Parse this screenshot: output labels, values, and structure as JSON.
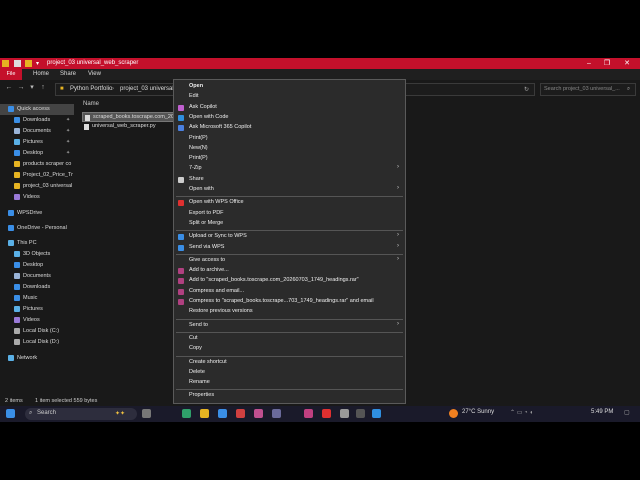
{
  "window": {
    "title": "project_03 universal_web_scraper"
  },
  "ribbon": {
    "tabs": [
      "File",
      "Home",
      "Share",
      "View"
    ]
  },
  "address": {
    "crumbs": [
      "Python Portfolio",
      "project_03 universal_w"
    ],
    "search_placeholder": "Search project_03 universal_..."
  },
  "nav": {
    "items": [
      {
        "label": "Quick access",
        "icon": "star-icon",
        "color": "#3a8ee6"
      },
      {
        "label": "Downloads",
        "icon": "download-icon",
        "color": "#3a8ee6",
        "pinned": true
      },
      {
        "label": "Documents",
        "icon": "documents-icon",
        "color": "#9ab4d8",
        "pinned": true
      },
      {
        "label": "Pictures",
        "icon": "pictures-icon",
        "color": "#5ab0e6",
        "pinned": true
      },
      {
        "label": "Desktop",
        "icon": "desktop-icon",
        "color": "#3a8ee6",
        "pinned": true
      },
      {
        "label": "products scraper co",
        "icon": "folder-icon",
        "color": "#e6b422"
      },
      {
        "label": "Project_02_Price_Tr",
        "icon": "folder-icon",
        "color": "#e6b422"
      },
      {
        "label": "project_03 universal",
        "icon": "folder-icon",
        "color": "#e6b422"
      },
      {
        "label": "Videos",
        "icon": "videos-icon",
        "color": "#9a7ad8"
      },
      {
        "label": "WPSDrive",
        "icon": "cloud-icon",
        "color": "#3a8ee6"
      },
      {
        "label": "OneDrive - Personal",
        "icon": "onedrive-icon",
        "color": "#3a8ee6"
      },
      {
        "label": "This PC",
        "icon": "pc-icon",
        "color": "#5ab0e6"
      },
      {
        "label": "3D Objects",
        "icon": "cube-icon",
        "color": "#5ab0e6"
      },
      {
        "label": "Desktop",
        "icon": "desktop-icon",
        "color": "#3a8ee6"
      },
      {
        "label": "Documents",
        "icon": "documents-icon",
        "color": "#9ab4d8"
      },
      {
        "label": "Downloads",
        "icon": "download-icon",
        "color": "#3a8ee6"
      },
      {
        "label": "Music",
        "icon": "music-icon",
        "color": "#3a8ee6"
      },
      {
        "label": "Pictures",
        "icon": "pictures-icon",
        "color": "#5ab0e6"
      },
      {
        "label": "Videos",
        "icon": "videos-icon",
        "color": "#9a7ad8"
      },
      {
        "label": "Local Disk (C:)",
        "icon": "disk-icon",
        "color": "#aaaaaa"
      },
      {
        "label": "Local Disk (D:)",
        "icon": "disk-icon",
        "color": "#aaaaaa"
      },
      {
        "label": "Network",
        "icon": "network-icon",
        "color": "#5ab0e6"
      }
    ]
  },
  "files": {
    "column_name": "Name",
    "items": [
      {
        "name": "scraped_books.toscrape.com_20",
        "selected": true
      },
      {
        "name": "universal_web_scraper.py",
        "selected": false
      }
    ]
  },
  "status": {
    "count": "2 items",
    "selection": "1 item selected  559 bytes"
  },
  "menu": {
    "items": [
      {
        "label": "Open",
        "bold": true
      },
      {
        "label": "Edit"
      },
      {
        "label": "Ask Copilot",
        "icon": "copilot-icon",
        "color": "#c060d0"
      },
      {
        "label": "Open with Code",
        "icon": "vscode-icon",
        "color": "#2f8fe0"
      },
      {
        "label": "Ask Microsoft 365 Copilot",
        "icon": "m365-copilot-icon",
        "color": "#4a80e0"
      },
      {
        "label": "Print(P)"
      },
      {
        "label": "New(N)"
      },
      {
        "label": "Print(P)"
      },
      {
        "label": "7-Zip",
        "submenu": true
      },
      {
        "label": "Share",
        "icon": "share-icon",
        "color": "#cccccc"
      },
      {
        "label": "Open with",
        "submenu": true
      },
      {
        "sep": true
      },
      {
        "label": "Open with WPS Office",
        "icon": "wps-icon",
        "color": "#e03030"
      },
      {
        "label": "Export to PDF"
      },
      {
        "label": "Split or Merge"
      },
      {
        "sep": true
      },
      {
        "label": "Upload or Sync to WPS",
        "icon": "cloud-upload-icon",
        "color": "#3a8ee6",
        "submenu": true
      },
      {
        "label": "Send via WPS",
        "icon": "send-icon",
        "color": "#3a8ee6",
        "submenu": true
      },
      {
        "sep": true
      },
      {
        "label": "Give access to",
        "submenu": true
      },
      {
        "label": "Add to archive...",
        "icon": "winrar-icon",
        "color": "#b04080"
      },
      {
        "label": "Add to \"scraped_books.toscrape.com_20260703_1749_headings.rar\"",
        "icon": "winrar-icon",
        "color": "#b04080"
      },
      {
        "label": "Compress and email...",
        "icon": "winrar-icon",
        "color": "#b04080"
      },
      {
        "label": "Compress to \"scraped_books.toscrape...703_1749_headings.rar\" and email",
        "icon": "winrar-icon",
        "color": "#b04080"
      },
      {
        "label": "Restore previous versions"
      },
      {
        "sep": true
      },
      {
        "label": "Send to",
        "submenu": true
      },
      {
        "sep": true
      },
      {
        "label": "Cut"
      },
      {
        "label": "Copy"
      },
      {
        "sep": true
      },
      {
        "label": "Create shortcut"
      },
      {
        "label": "Delete"
      },
      {
        "label": "Rename"
      },
      {
        "sep": true
      },
      {
        "label": "Properties"
      }
    ]
  },
  "taskbar": {
    "search_label": "Search",
    "weather": "27°C  Sunny",
    "time": "5:49 PM"
  },
  "colors": {
    "accent": "#c4102b",
    "menu_bg": "#2b2b2b",
    "background": "#191919"
  }
}
